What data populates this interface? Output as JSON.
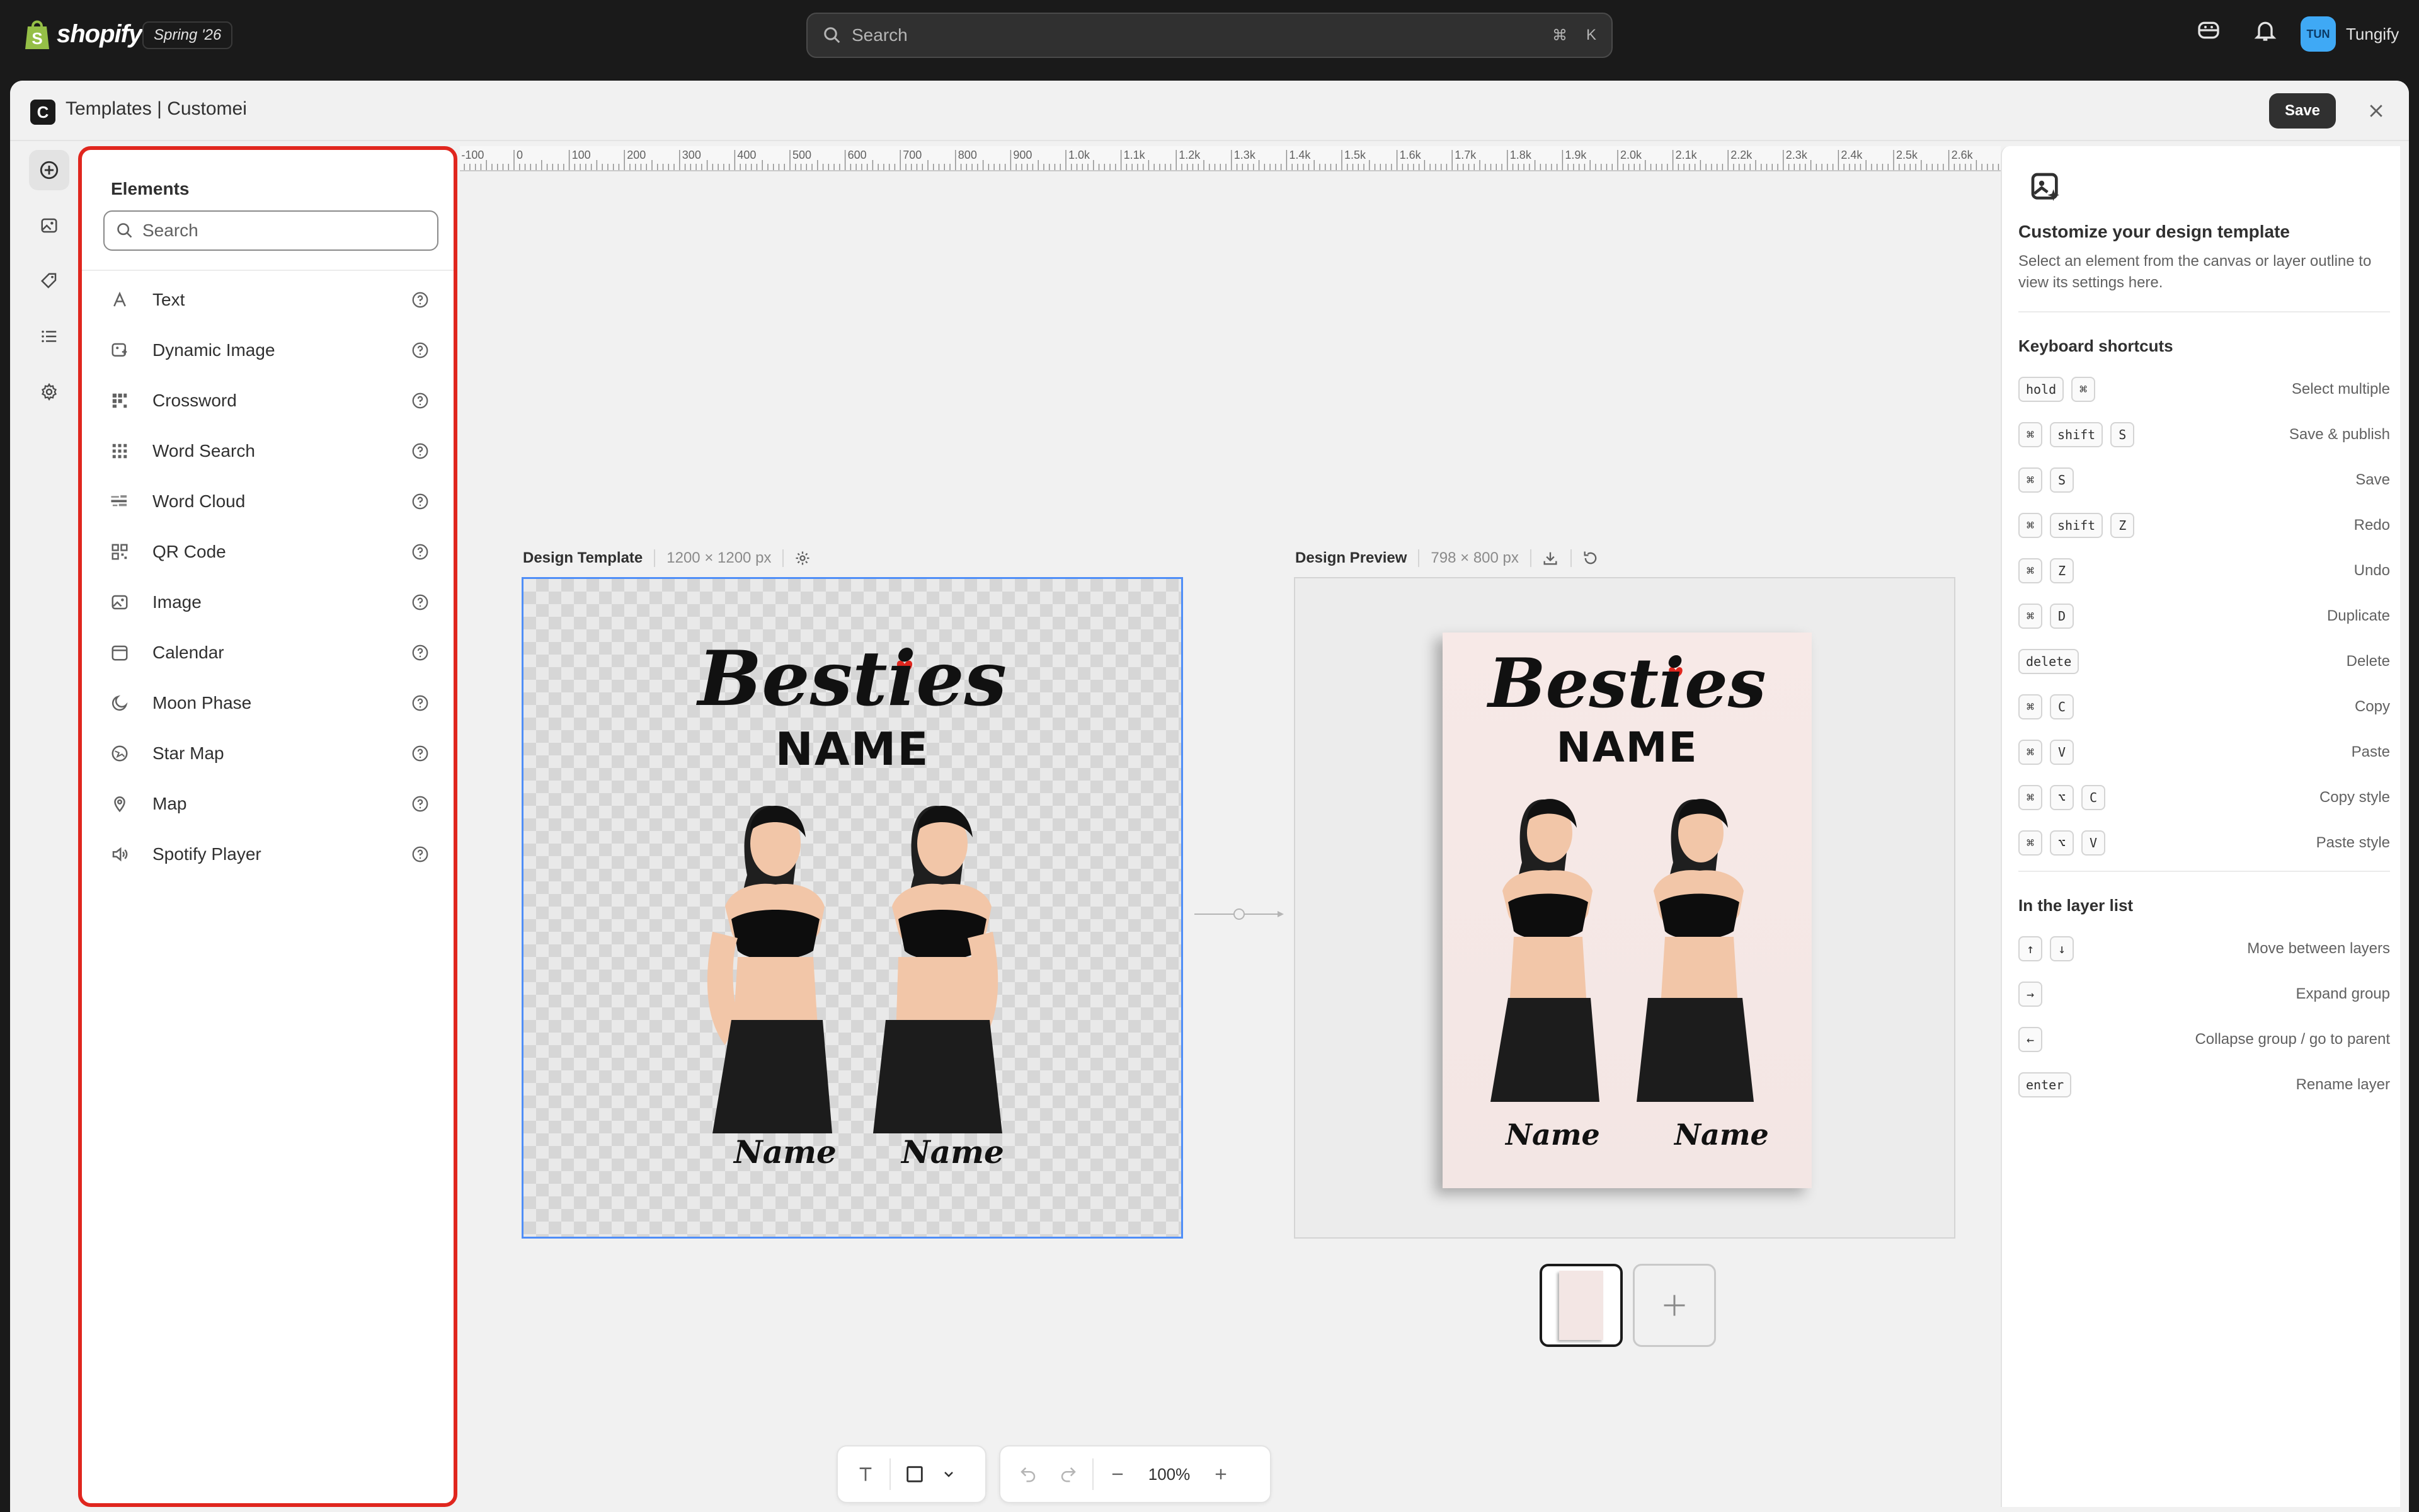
{
  "topbar": {
    "brand": "shopify",
    "edition": "Spring '26",
    "search_placeholder": "Search",
    "shortcut_cmd": "⌘",
    "shortcut_key": "K",
    "store_initials": "TUN",
    "store_name": "Tungify"
  },
  "app": {
    "icon_letter": "C",
    "title": "Templates | Customei",
    "save_label": "Save"
  },
  "elements_panel": {
    "title": "Elements",
    "search_placeholder": "Search",
    "items": [
      {
        "label": "Text",
        "icon": "text-icon"
      },
      {
        "label": "Dynamic Image",
        "icon": "dynamic-image-icon"
      },
      {
        "label": "Crossword",
        "icon": "crossword-icon"
      },
      {
        "label": "Word Search",
        "icon": "word-search-icon"
      },
      {
        "label": "Word Cloud",
        "icon": "word-cloud-icon"
      },
      {
        "label": "QR Code",
        "icon": "qr-code-icon"
      },
      {
        "label": "Image",
        "icon": "image-icon"
      },
      {
        "label": "Calendar",
        "icon": "calendar-icon"
      },
      {
        "label": "Moon Phase",
        "icon": "moon-icon"
      },
      {
        "label": "Star Map",
        "icon": "star-map-icon"
      },
      {
        "label": "Map",
        "icon": "map-pin-icon"
      },
      {
        "label": "Spotify Player",
        "icon": "speaker-icon"
      }
    ]
  },
  "ruler": {
    "labels": [
      "-100",
      "0",
      "100",
      "200",
      "300",
      "400",
      "500",
      "600",
      "700",
      "800",
      "900",
      "1.0k",
      "1.1k",
      "1.2k",
      "1.3k",
      "1.4k",
      "1.5k",
      "1.6k",
      "1.7k",
      "1.8k",
      "1.9k",
      "2.0k",
      "2.1k",
      "2.2k",
      "2.3k",
      "2.4k",
      "2.5k",
      "2.6k"
    ]
  },
  "design_template": {
    "label": "Design Template",
    "size": "1200 × 1200 px"
  },
  "design_preview": {
    "label": "Design Preview",
    "size": "798 × 800 px"
  },
  "artwork": {
    "title": "Besties",
    "subtitle": "NAME",
    "name_left": "Name",
    "name_right": "Name"
  },
  "toolbar": {
    "zoom": "100%"
  },
  "right_panel": {
    "title": "Customize your design template",
    "description": "Select an element from the canvas or layer outline to view its settings here.",
    "shortcuts_title": "Keyboard shortcuts",
    "shortcuts": [
      {
        "keys": [
          "hold",
          "⌘"
        ],
        "action": "Select multiple"
      },
      {
        "keys": [
          "⌘",
          "shift",
          "S"
        ],
        "action": "Save & publish"
      },
      {
        "keys": [
          "⌘",
          "S"
        ],
        "action": "Save"
      },
      {
        "keys": [
          "⌘",
          "shift",
          "Z"
        ],
        "action": "Redo"
      },
      {
        "keys": [
          "⌘",
          "Z"
        ],
        "action": "Undo"
      },
      {
        "keys": [
          "⌘",
          "D"
        ],
        "action": "Duplicate"
      },
      {
        "keys": [
          "delete"
        ],
        "action": "Delete"
      },
      {
        "keys": [
          "⌘",
          "C"
        ],
        "action": "Copy"
      },
      {
        "keys": [
          "⌘",
          "V"
        ],
        "action": "Paste"
      },
      {
        "keys": [
          "⌘",
          "⌥",
          "C"
        ],
        "action": "Copy style"
      },
      {
        "keys": [
          "⌘",
          "⌥",
          "V"
        ],
        "action": "Paste style"
      }
    ],
    "layer_title": "In the layer list",
    "layer_shortcuts": [
      {
        "keys": [
          "↑",
          "↓"
        ],
        "action": "Move between layers"
      },
      {
        "keys": [
          "→"
        ],
        "action": "Expand group"
      },
      {
        "keys": [
          "←"
        ],
        "action": "Collapse group / go to parent"
      },
      {
        "keys": [
          "enter"
        ],
        "action": "Rename layer"
      }
    ]
  }
}
